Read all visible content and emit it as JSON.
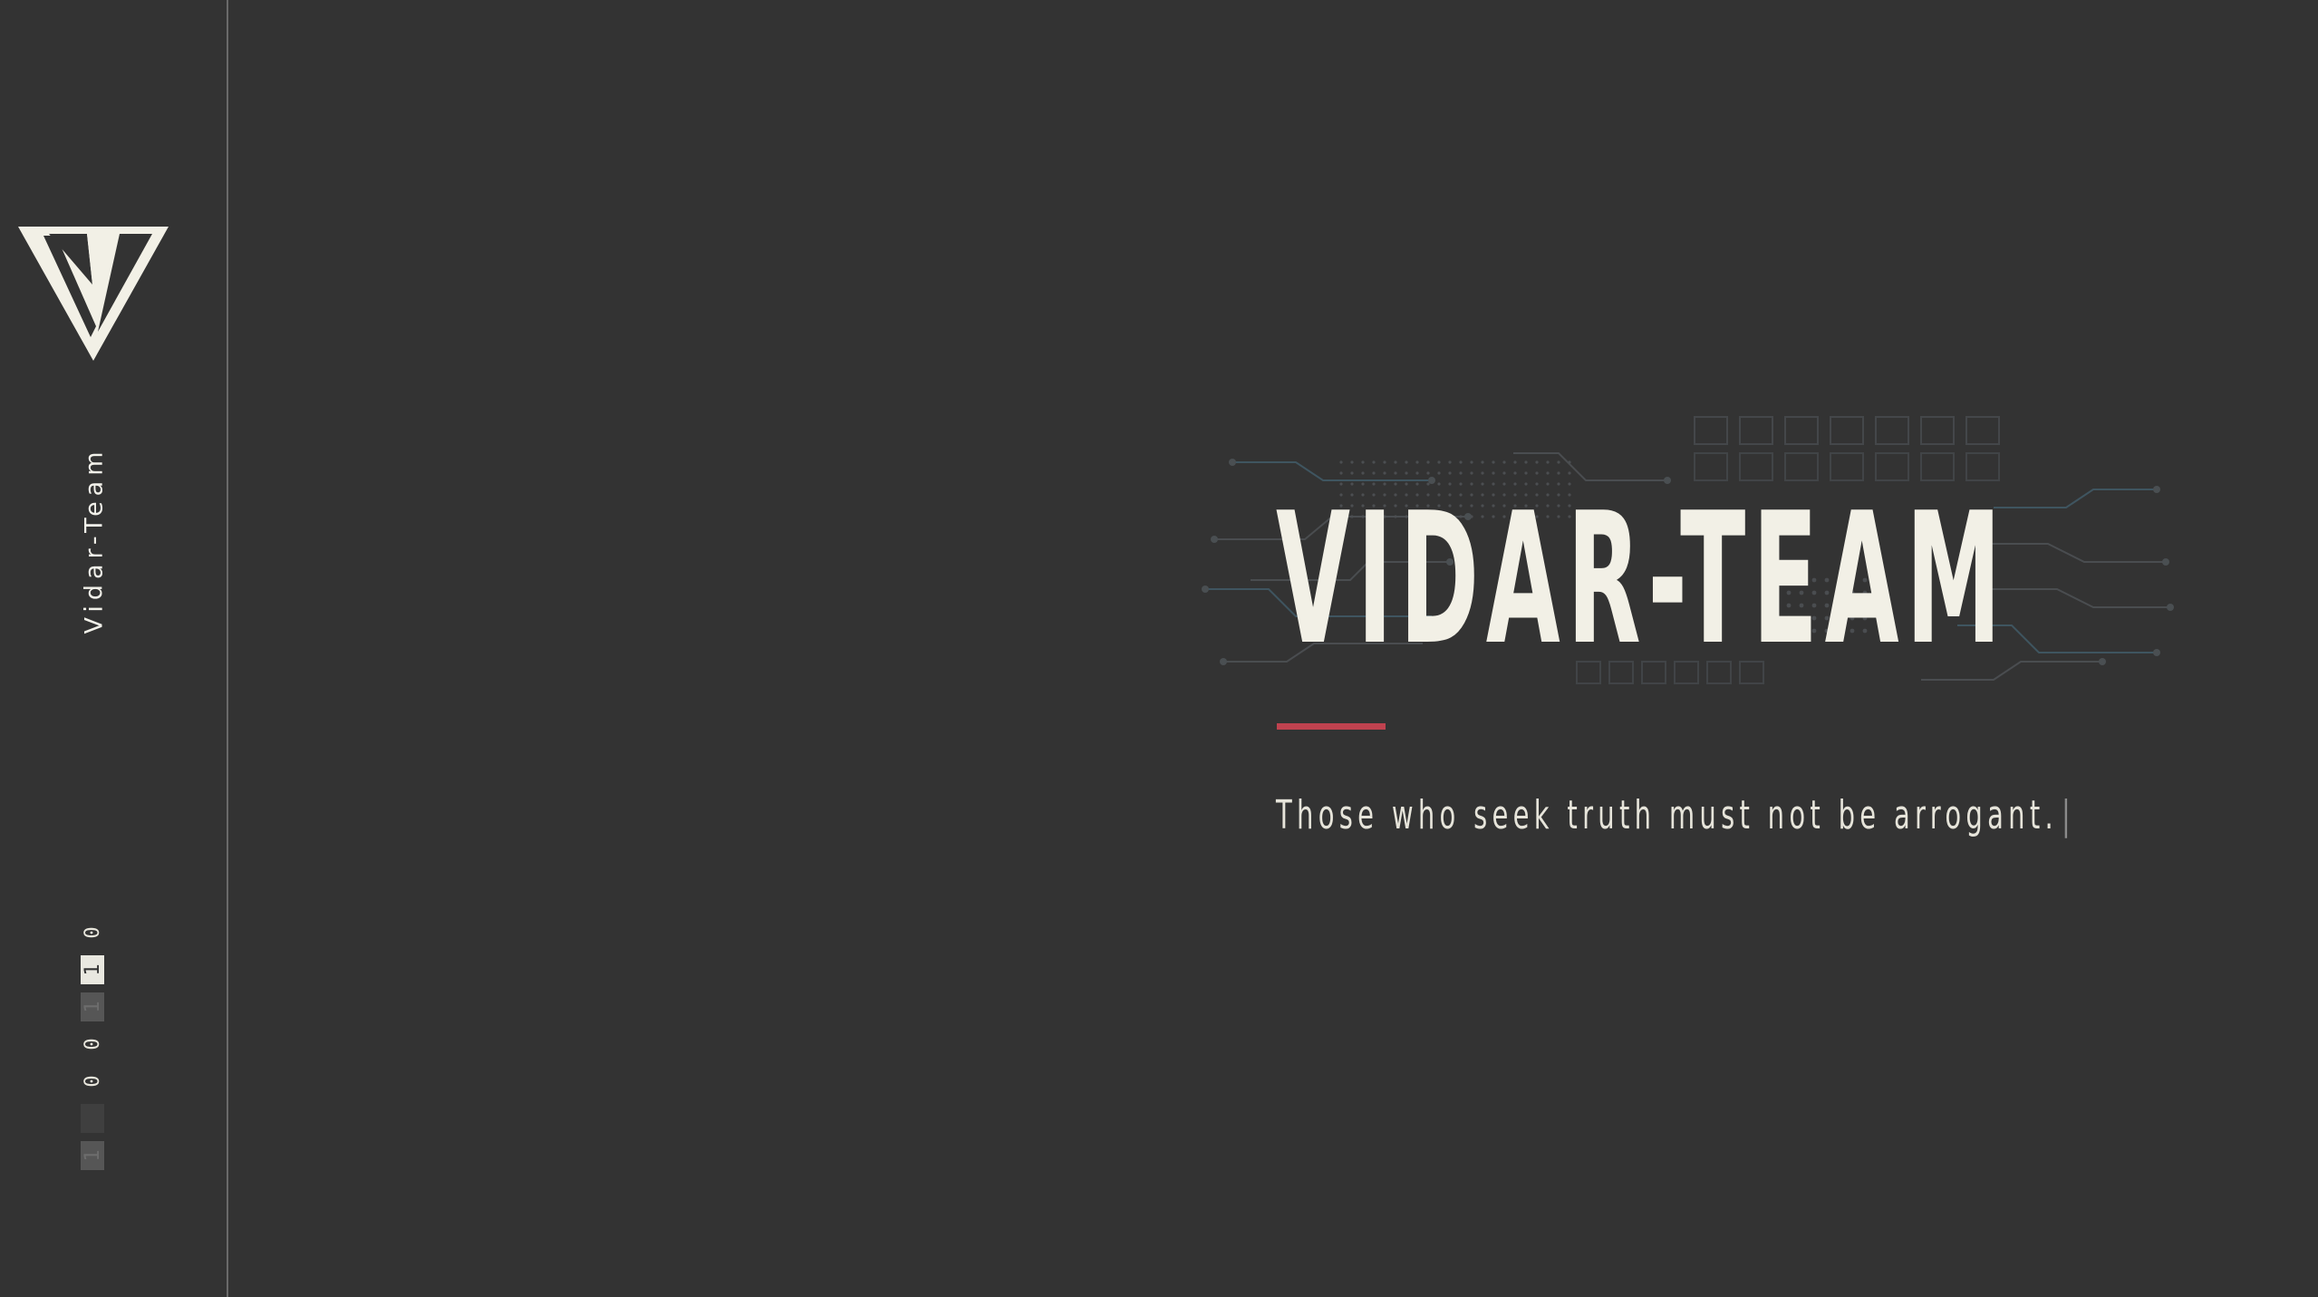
{
  "sidebar": {
    "brand_name": "Vidar-Team",
    "bits": [
      {
        "text": "0",
        "style": "plain"
      },
      {
        "text": "1",
        "style": "filled"
      },
      {
        "text": "1",
        "style": "dim"
      },
      {
        "text": "0",
        "style": "plain"
      },
      {
        "text": "0",
        "style": "plain"
      },
      {
        "text": "",
        "style": "faint"
      },
      {
        "text": "1",
        "style": "dim"
      }
    ]
  },
  "hero": {
    "title": "VIDAR-TEAM",
    "tagline": "Those who seek truth must not be arrogant.",
    "cursor": "|"
  },
  "colors": {
    "background": "#333333",
    "text": "#f2f0e6",
    "accent": "#c0424f",
    "divider": "#6a6a6a"
  },
  "icons": {
    "logo": "v-logo-icon"
  }
}
